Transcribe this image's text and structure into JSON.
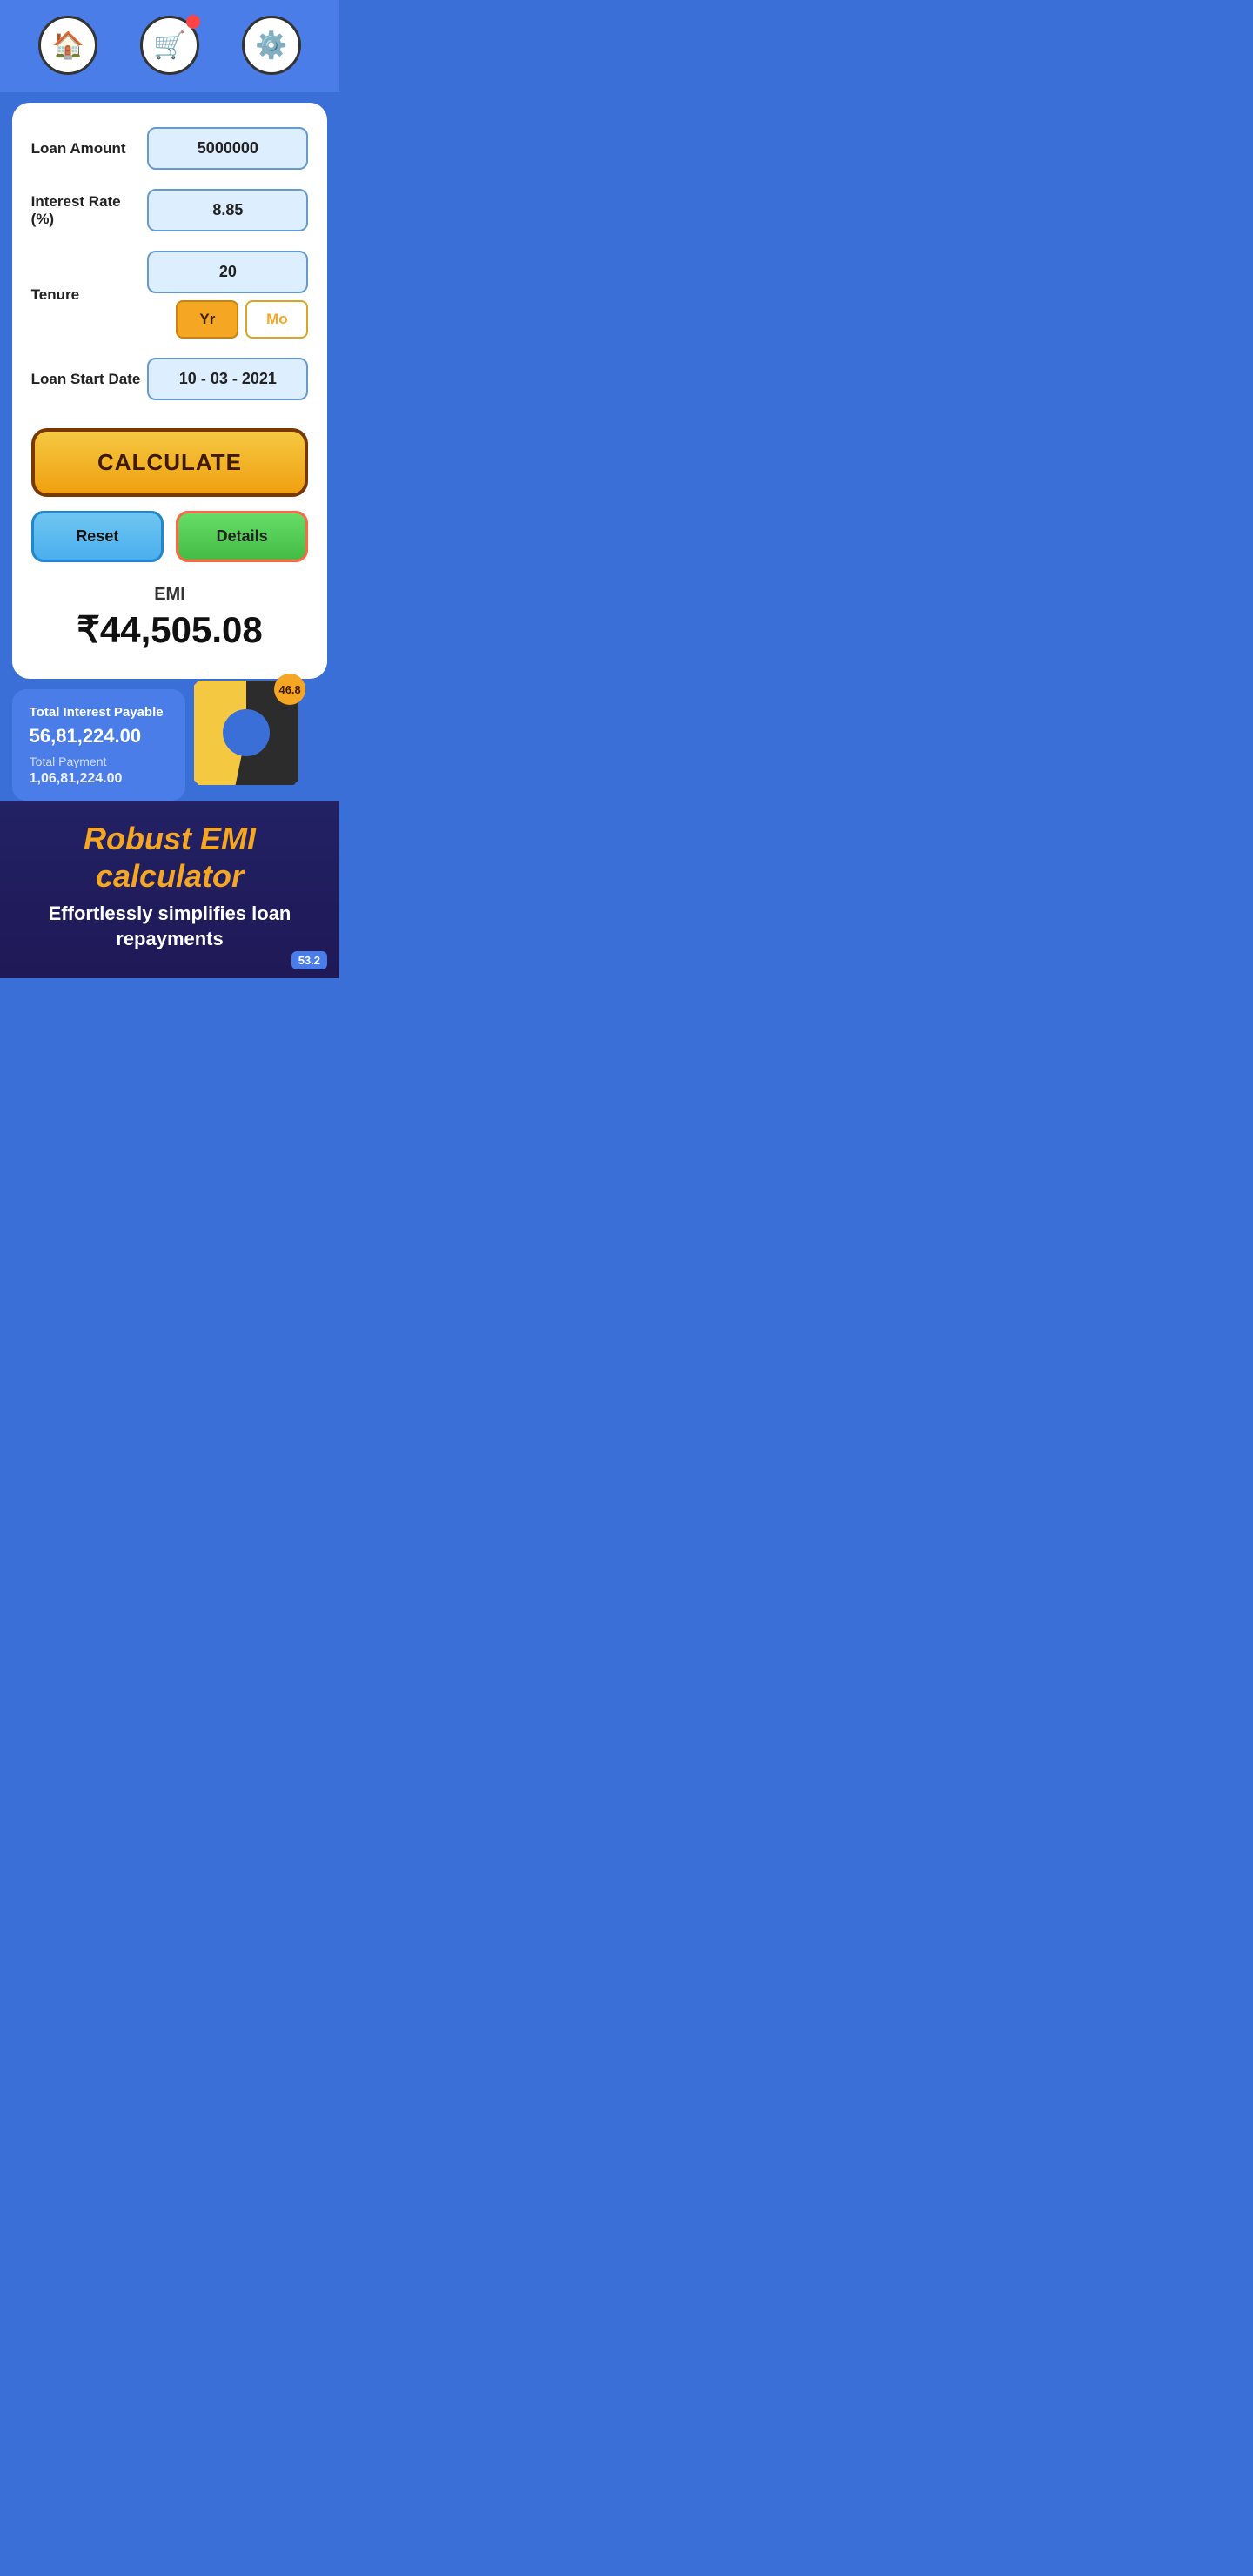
{
  "header": {
    "home_icon": "🏠",
    "cart_icon": "🛒",
    "settings_icon": "⚙️"
  },
  "form": {
    "loan_amount_label": "Loan Amount",
    "loan_amount_value": "5000000",
    "interest_rate_label": "Interest Rate (%)",
    "interest_rate_value": "8.85",
    "tenure_label": "Tenure",
    "tenure_value": "20",
    "tenure_yr_label": "Yr",
    "tenure_mo_label": "Mo",
    "loan_start_label": "Loan Start Date",
    "loan_start_value": "10 - 03 - 2021",
    "calculate_label": "CALCULATE",
    "reset_label": "Reset",
    "details_label": "Details"
  },
  "result": {
    "emi_label": "EMI",
    "emi_value": "₹44,505.08",
    "interest_title": "Total Interest Payable",
    "interest_value": "56,81,224.00",
    "total_payment_label": "Total Payment",
    "total_payment_value": "1,06,81,224.00",
    "pie_badge_value": "46.8",
    "version_badge": "53.2"
  },
  "branding": {
    "title": "Robust EMI calculator",
    "subtitle": "Effortlessly simplifies loan repayments"
  },
  "pie": {
    "principal_pct": 53.2,
    "interest_pct": 46.8,
    "principal_color": "#2c2c2c",
    "interest_color": "#f5c842"
  }
}
